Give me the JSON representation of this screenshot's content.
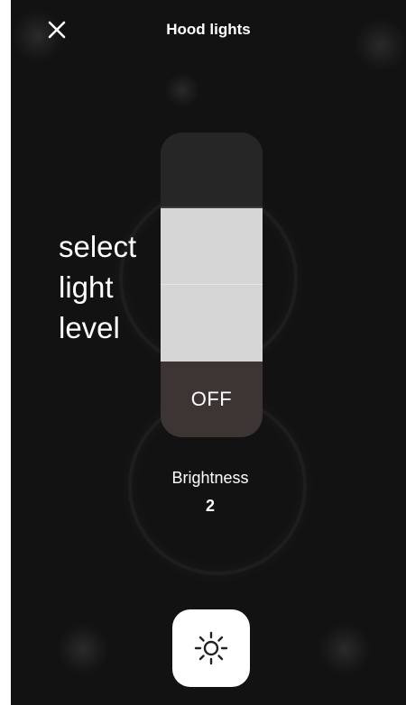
{
  "header": {
    "title": "Hood lights",
    "close_icon": "close-icon"
  },
  "level_selector": {
    "instruction_lines": [
      "select",
      "light",
      "level"
    ],
    "off_label": "OFF",
    "total_levels": 4,
    "active_level": 2
  },
  "brightness": {
    "label": "Brightness",
    "value": "2"
  },
  "footer": {
    "light_button_icon": "sun-icon"
  },
  "colors": {
    "background": "#121212",
    "slider_inactive": "#262626",
    "slider_active": "#d6d6d6",
    "slider_off": "#3d3534",
    "text": "#ffffff"
  }
}
